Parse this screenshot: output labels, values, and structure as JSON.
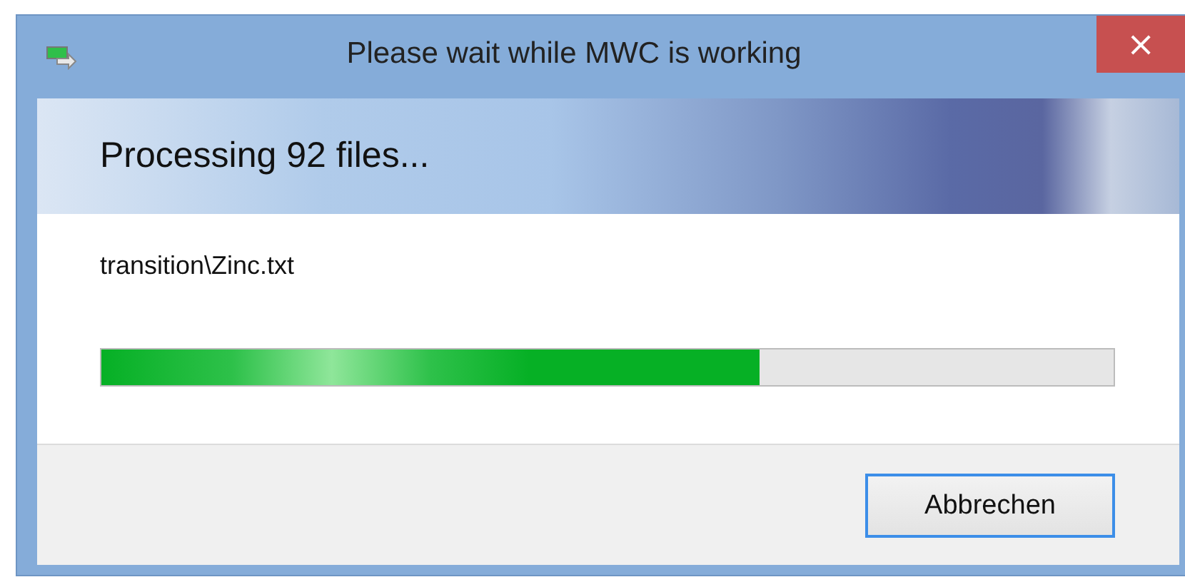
{
  "window": {
    "title": "Please wait while MWC is working",
    "close": "×"
  },
  "header": {
    "text": "Processing 92 files..."
  },
  "current_file": "transition\\Zinc.txt",
  "progress": {
    "level": 0.65
  },
  "buttons": [
    {
      "label": "Abbrechen",
      "focused": true
    }
  ]
}
